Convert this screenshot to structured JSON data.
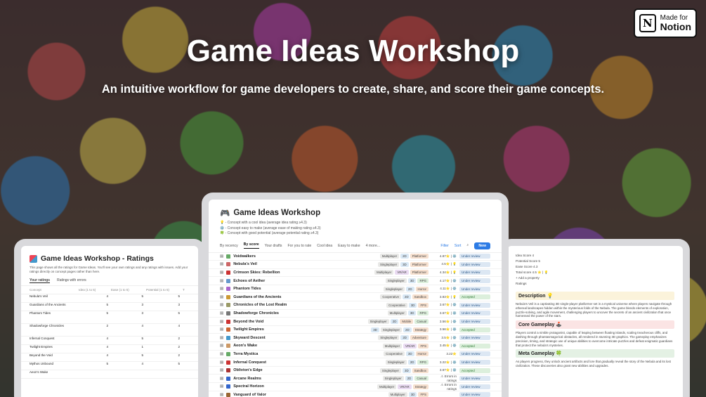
{
  "badge": {
    "line1": "Made for",
    "line2": "Notion"
  },
  "hero": {
    "title": "Game Ideas Workshop",
    "subtitle": "An intuitive workflow for game developers to create, share, and score their game concepts."
  },
  "left_panel": {
    "title": "Game Ideas Workshop - Ratings",
    "desc": "This page shows all the ratings for Game Ideas. You'll see your own ratings and any ratings with issues. Add your ratings directly on concept pages rather than here.",
    "tabs": [
      "Your ratings",
      "Ratings with errors"
    ],
    "headers": [
      "Concept",
      "Idea (1 to 5)",
      "Ease (1 to 5)",
      "Potential (1 to 5)",
      "T"
    ],
    "rows": [
      {
        "name": "Nebula's Veil",
        "idea": "4",
        "ease": "5",
        "pot": "5"
      },
      {
        "name": "Guardians of the Ancients",
        "idea": "5",
        "ease": "3",
        "pot": "3"
      },
      {
        "name": "Phantom Tides",
        "idea": "5",
        "ease": "3",
        "pot": "5"
      },
      {
        "name": "Shadowforge Chronicles",
        "idea": "2",
        "ease": "4",
        "pot": "4"
      },
      {
        "name": "Infernal Conquest",
        "idea": "4",
        "ease": "5",
        "pot": "2"
      },
      {
        "name": "Twilight Empires",
        "idea": "4",
        "ease": "1",
        "pot": "2"
      },
      {
        "name": "Beyond the Void",
        "idea": "4",
        "ease": "5",
        "pot": "2"
      },
      {
        "name": "Mythos Unbound",
        "idea": "5",
        "ease": "4",
        "pot": "5"
      },
      {
        "name": "Aeon's Wake",
        "idea": "",
        "ease": "",
        "pot": ""
      }
    ]
  },
  "center_panel": {
    "title": "Game Ideas Workshop",
    "legend": [
      "💡 - Concept with a cool idea (average idea rating ≥4.3)",
      "⚙️ - Concept easy to make (average ease of making rating ≥4.3)",
      "🍀 - Concept with good potential (average potential rating ≥4.3)"
    ],
    "tabs": [
      "By recency",
      "By score",
      "Your drafts",
      "For you to rate",
      "Cool idea",
      "Easy to make",
      "4 more..."
    ],
    "filter": "Filter",
    "sort": "Sort",
    "new": "New",
    "rows": [
      {
        "name": "Voidwalkers",
        "tags": [
          [
            "Multiplayer",
            ""
          ],
          [
            "2D",
            "b"
          ],
          [
            "Platformer",
            "o"
          ]
        ],
        "score": "4.87⭐ | ⚙️",
        "status": "Under review",
        "s": ""
      },
      {
        "name": "Nebula's Veil",
        "tags": [
          [
            "Singleplayer",
            ""
          ],
          [
            "3D",
            "b"
          ],
          [
            "Platformer",
            "o"
          ]
        ],
        "score": "4.5⭐ | 💡",
        "status": "Under review",
        "s": ""
      },
      {
        "name": "Crimson Skies: Rebellion",
        "tags": [
          [
            "Multiplayer",
            ""
          ],
          [
            "VR/AR",
            "p"
          ],
          [
            "Platformer",
            "o"
          ]
        ],
        "score": "4.34⭐ | 💡",
        "status": "Under review",
        "s": ""
      },
      {
        "name": "Echoes of Aether",
        "tags": [
          [
            "Singleplayer",
            ""
          ],
          [
            "3D",
            "b"
          ],
          [
            "RPG",
            "g"
          ]
        ],
        "score": "4.17⭐ | ⚙️",
        "status": "Under review",
        "s": ""
      },
      {
        "name": "Phantom Tides",
        "tags": [
          [
            "Singleplayer",
            ""
          ],
          [
            "2D",
            "b"
          ],
          [
            "Horror",
            "o"
          ]
        ],
        "score": "4.11⭐ | ⚙️",
        "status": "Under review",
        "s": ""
      },
      {
        "name": "Guardians of the Ancients",
        "tags": [
          [
            "Cooperative",
            ""
          ],
          [
            "2D",
            "b"
          ],
          [
            "Sandbox",
            "o"
          ]
        ],
        "score": "3.83⭐ | 💡",
        "status": "Accepted",
        "s": "a"
      },
      {
        "name": "Chronicles of the Lost Realm",
        "tags": [
          [
            "Cooperative",
            ""
          ],
          [
            "3D",
            "b"
          ],
          [
            "FPS",
            "o"
          ]
        ],
        "score": "3.67⭐ | ⚙️",
        "status": "Under review",
        "s": ""
      },
      {
        "name": "Shadowforge Chronicles",
        "tags": [
          [
            "Multiplayer",
            ""
          ],
          [
            "3D",
            "b"
          ],
          [
            "RPG",
            "g"
          ]
        ],
        "score": "3.67⭐ | ⚙️",
        "status": "Under review",
        "s": ""
      },
      {
        "name": "Beyond the Void",
        "tags": [
          [
            "Singleplayer",
            ""
          ],
          [
            "2D",
            "b"
          ],
          [
            "Mobile",
            "o"
          ],
          [
            "Casual",
            "g"
          ]
        ],
        "score": "3.56⭐ | ⚙️",
        "status": "Under review",
        "s": ""
      },
      {
        "name": "Twilight Empires",
        "tags": [
          [
            "3D",
            "b"
          ],
          [
            "Singleplayer",
            ""
          ],
          [
            "2D",
            "b"
          ],
          [
            "Strategy",
            "o"
          ]
        ],
        "score": "3.56⭐ | ⚙️",
        "status": "Accepted",
        "s": "a"
      },
      {
        "name": "Skyward Descent",
        "tags": [
          [
            "Singleplayer",
            ""
          ],
          [
            "2D",
            "b"
          ],
          [
            "Adventure",
            "o"
          ]
        ],
        "score": "3.5⭐ | ⚙️",
        "status": "Under review",
        "s": ""
      },
      {
        "name": "Aeon's Wake",
        "tags": [
          [
            "Multiplayer",
            ""
          ],
          [
            "VR/AR",
            "p"
          ],
          [
            "FPS",
            "o"
          ]
        ],
        "score": "3.45⭐ | ⚙️",
        "status": "Accepted",
        "s": "a"
      },
      {
        "name": "Terra Mystica",
        "tags": [
          [
            "Cooperative",
            ""
          ],
          [
            "3D",
            "b"
          ],
          [
            "Horror",
            "o"
          ]
        ],
        "score": "3.22⭐",
        "status": "Under review",
        "s": ""
      },
      {
        "name": "Infernal Conquest",
        "tags": [
          [
            "Singleplayer",
            ""
          ],
          [
            "2D",
            "b"
          ],
          [
            "RPG",
            "g"
          ]
        ],
        "score": "3.22⭐ | ⚙️",
        "status": "Under review",
        "s": ""
      },
      {
        "name": "Oblivion's Edge",
        "tags": [
          [
            "Singleplayer",
            ""
          ],
          [
            "3D",
            "b"
          ],
          [
            "Sandbox",
            "o"
          ]
        ],
        "score": "3.67⭐ | ⚙️",
        "status": "Accepted",
        "s": "a"
      },
      {
        "name": "Arcane Realms",
        "tags": [
          [
            "Singleplayer",
            ""
          ],
          [
            "2D",
            "b"
          ],
          [
            "Casual",
            "g"
          ]
        ],
        "score": "⚠ Errors in ratings",
        "status": "Under review",
        "s": ""
      },
      {
        "name": "Spectral Horizon",
        "tags": [
          [
            "Multiplayer",
            ""
          ],
          [
            "VR/AR",
            "p"
          ],
          [
            "Strategy",
            "o"
          ]
        ],
        "score": "⚠ Errors in ratings",
        "status": "Under review",
        "s": ""
      },
      {
        "name": "Vanguard of Valor",
        "tags": [
          [
            "Multiplayer",
            ""
          ],
          [
            "3D",
            "b"
          ],
          [
            "FPS",
            "o"
          ]
        ],
        "score": "",
        "status": "Under review",
        "s": ""
      }
    ]
  },
  "right_panel": {
    "props": [
      "Idea Score  4",
      "Potential Score  5",
      "Ease Score  4.3",
      "Total score  4.5 ⭐ | 💡",
      "+ Add a property"
    ],
    "ratings_label": "Ratings",
    "sec1": "Description 💡",
    "txt1": "Nebula's Veil is a captivating 3D single-player platformer set in a mystical universe where players navigate through ethereal landscapes hidden within the mysterious folds of the Nebula. The game blends elements of exploration, puzzle-solving, and agile movement, challenging players to uncover the secrets of an ancient civilization that once harnessed the power of the stars.",
    "sec2": "Core Gameplay 🕹️",
    "txt2": "Players control a nimble protagonist, capable of leaping between floating islands, scaling treacherous cliffs, and dashing through phantasmagorical obstacles, all rendered in stunning 3D graphics. The gameplay emphasizes precision, timing, and strategic use of unique abilities to overcome intricate puzzles and defeat enigmatic guardians that protect the nebula's mysteries.",
    "sec3": "Meta Gameplay 🍀",
    "txt3": "As players progress, they unlock ancient artifacts and lore that gradually reveal the story of the Nebula and its lost civilization. These discoveries also grant new abilities and upgrades."
  }
}
